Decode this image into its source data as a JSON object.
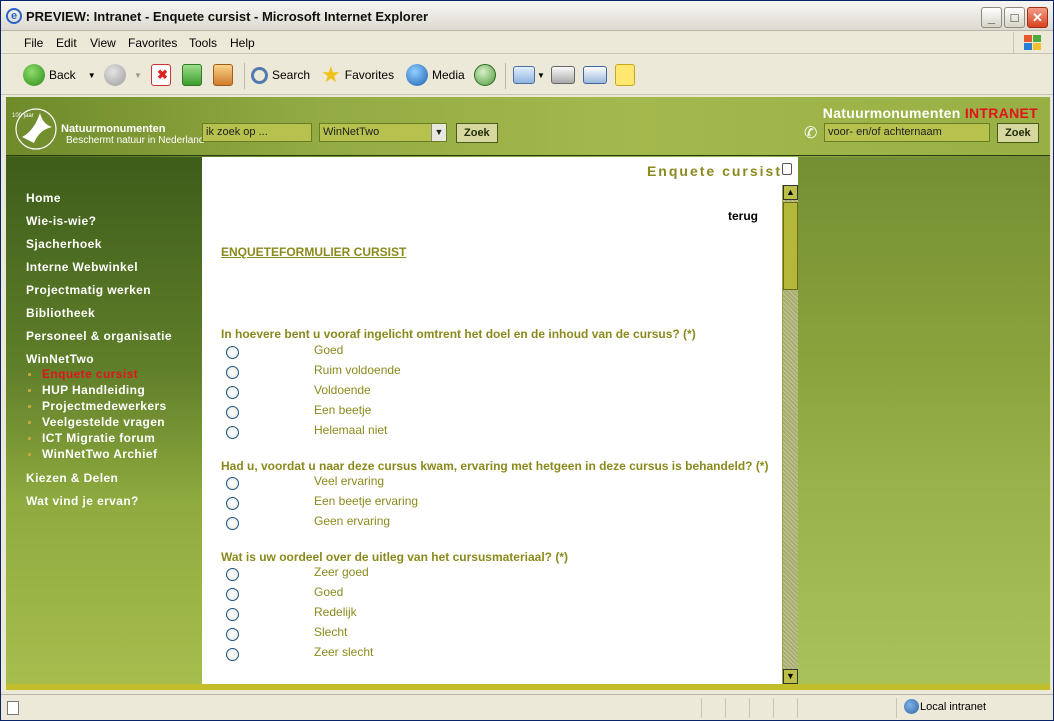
{
  "window": {
    "title": "PREVIEW: Intranet - Enquete cursist - Microsoft Internet Explorer"
  },
  "menu": [
    "File",
    "Edit",
    "View",
    "Favorites",
    "Tools",
    "Help"
  ],
  "toolbar": {
    "back": "Back",
    "search": "Search",
    "favorites": "Favorites",
    "media": "Media"
  },
  "header": {
    "logo_anniversary": "100 jaar",
    "logo_name": "Natuurmonumenten",
    "logo_tagline": "Beschermt natuur in Nederland",
    "search_placeholder": "ik zoek op ...",
    "site_select": "WinNetTwo",
    "search_button": "Zoek",
    "brand_name": "Natuurmonumenten",
    "brand_suffix": "INTRANET",
    "name_placeholder": "voor- en/of achternaam",
    "name_button": "Zoek"
  },
  "nav": {
    "items": [
      "Home",
      "Wie-is-wie?",
      "Sjacherhoek",
      "Interne Webwinkel",
      "Projectmatig werken",
      "Bibliotheek",
      "Personeel & organisatie",
      "WinNetTwo"
    ],
    "sub": [
      "Enquete cursist",
      "HUP Handleiding",
      "Projectmedewerkers",
      "Veelgestelde vragen",
      "ICT Migratie forum",
      "WinNetTwo Archief"
    ],
    "after": [
      "Kiezen & Delen",
      "Wat vind je ervan?"
    ]
  },
  "panel": {
    "title": "Enquete cursist",
    "back_link": "terug",
    "form_title": "ENQUETEFORMULIER CURSIST",
    "questions": [
      {
        "text": "In hoevere bent u vooraf ingelicht omtrent het doel en de inhoud van de cursus? (*)",
        "options": [
          "Goed",
          "Ruim voldoende",
          "Voldoende",
          "Een beetje",
          "Helemaal niet"
        ]
      },
      {
        "text": "Had u, voordat u naar deze cursus kwam, ervaring met hetgeen in deze cursus is behandeld? (*)",
        "options": [
          "Veel ervaring",
          "Een beetje ervaring",
          "Geen ervaring"
        ]
      },
      {
        "text": "Wat is uw oordeel over de uitleg van het cursusmateriaal? (*)",
        "options": [
          "Zeer goed",
          "Goed",
          "Redelijk",
          "Slecht",
          "Zeer slecht"
        ]
      }
    ]
  },
  "status": {
    "zone": "Local intranet"
  },
  "colors": {
    "accent": "#8a8a1c",
    "active": "#e0141e",
    "brand_highlight": "#e0141e"
  }
}
